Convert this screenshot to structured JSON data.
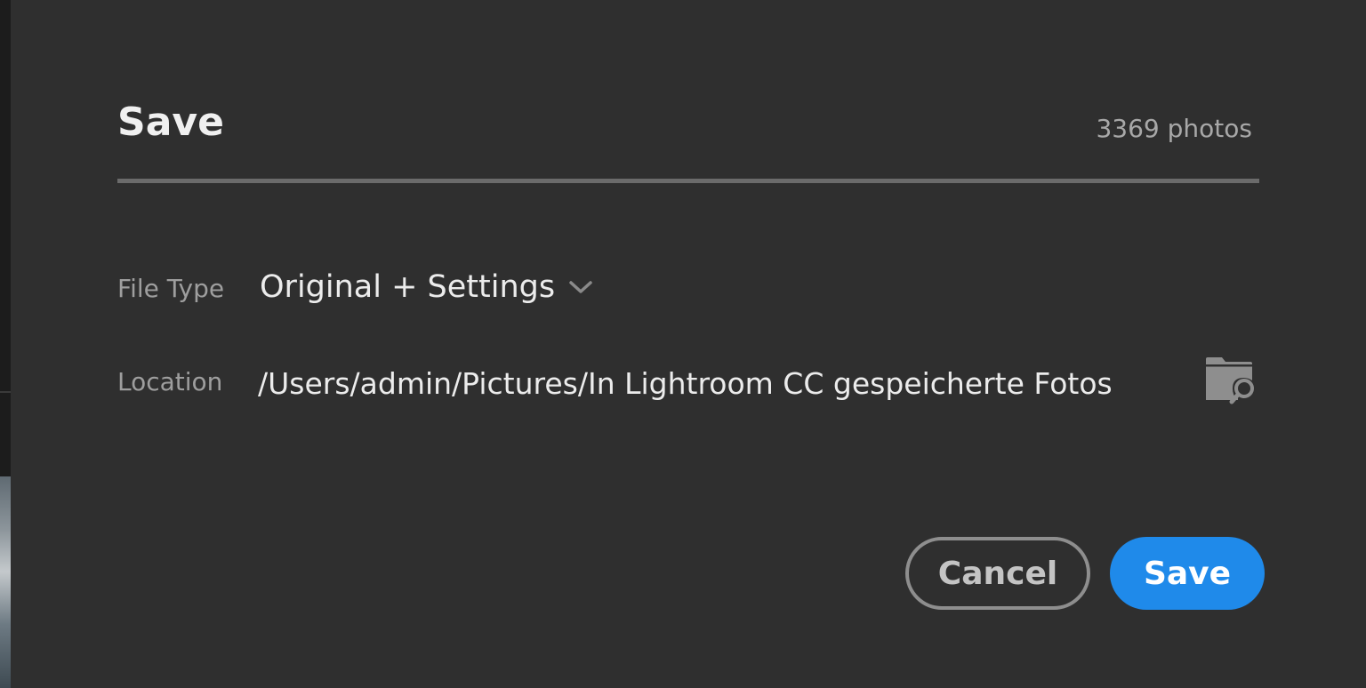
{
  "dialog": {
    "title": "Save",
    "photo_count": "3369 photos"
  },
  "file_type": {
    "label": "File Type",
    "value": "Original + Settings",
    "icon": "chevron-down-icon"
  },
  "location": {
    "label": "Location",
    "path": "/Users/admin/Pictures/In Lightroom CC gespeicherte Fotos",
    "browse_icon": "folder-search-icon"
  },
  "buttons": {
    "cancel_label": "Cancel",
    "save_label": "Save"
  },
  "colors": {
    "background": "#2f2f2f",
    "accent": "#1f8aea",
    "text_primary": "#ececec",
    "text_secondary": "#9e9e9e"
  }
}
